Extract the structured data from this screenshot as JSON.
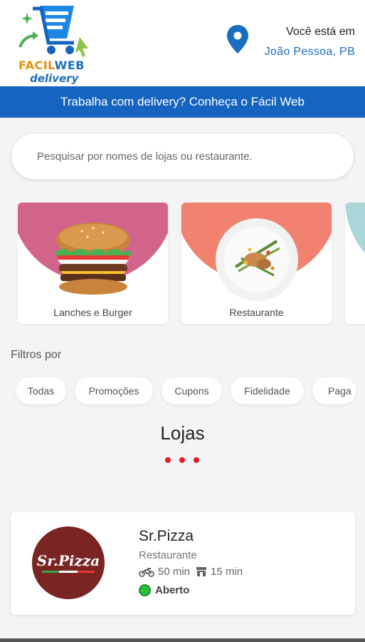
{
  "header": {
    "logo_word1": "FACIL",
    "logo_word2": "WEB",
    "logo_word3": "delivery",
    "location_title": "Você está em",
    "location_city": "João Pessoa, PB"
  },
  "banner": {
    "text": "Trabalha com delivery? Conheça o Fácil Web"
  },
  "search": {
    "placeholder": "Pesquisar por nomes de lojas ou restaurante."
  },
  "categories": [
    {
      "label": "Lanches e Burger",
      "color": "#d2648b",
      "icon": "burger-image"
    },
    {
      "label": "Restaurante",
      "color": "#f0826f",
      "icon": "plate-image"
    },
    {
      "label": "",
      "color": "#a8d6d9",
      "icon": ""
    }
  ],
  "filters": {
    "title": "Filtros por",
    "chips": [
      "Todas",
      "Promoções",
      "Cupons",
      "Fidelidade",
      "Paga"
    ]
  },
  "stores_section": {
    "title": "Lojas"
  },
  "store": {
    "name": "Sr.Pizza",
    "logo_text": "Sr.Pizza",
    "type": "Restaurante",
    "delivery_time": "50 min",
    "pickup_time": "15 min",
    "status": "Aberto",
    "status_color": "#2bbf3f"
  },
  "colors": {
    "accent": "#1565c0",
    "brand_orange": "#e8900c",
    "loader_red": "#e31b23"
  }
}
